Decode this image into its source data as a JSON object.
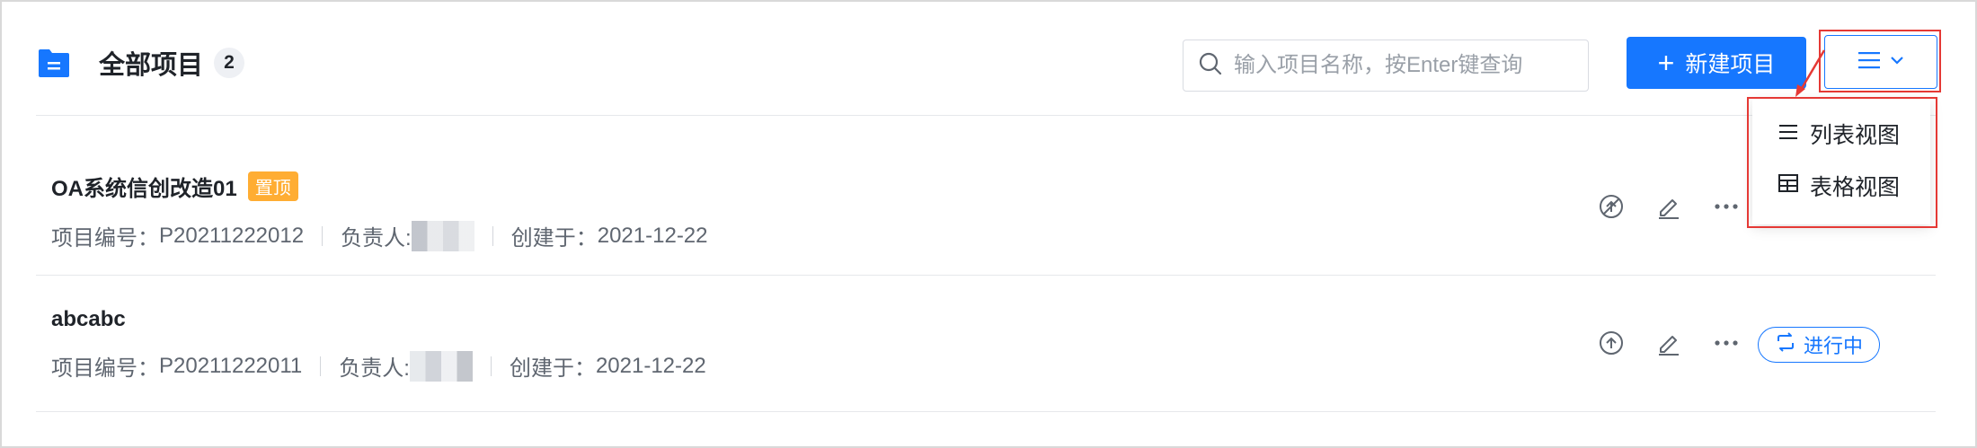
{
  "header": {
    "title": "全部项目",
    "count": "2",
    "icon": "folder-icon",
    "accent": "#1677ff"
  },
  "search": {
    "placeholder": "输入项目名称，按Enter键查询",
    "value": ""
  },
  "toolbar": {
    "new_project_label": "新建项目",
    "view_toggle_icon": "list-icon"
  },
  "view_menu": {
    "items": [
      {
        "label": "列表视图",
        "icon": "list-icon"
      },
      {
        "label": "表格视图",
        "icon": "table-icon"
      }
    ]
  },
  "projects": [
    {
      "name": "OA系统信创改造01",
      "tag": "置顶",
      "number_label": "项目编号：",
      "number": "P20211222012",
      "owner_label": "负责人:",
      "created_label": "创建于：",
      "created": "2021-12-22",
      "actions": [
        "unpin-icon",
        "edit-icon",
        "more-icon"
      ],
      "tag_color": "#ffad33"
    },
    {
      "name": "abcabc",
      "number_label": "项目编号：",
      "number": "P20211222011",
      "owner_label": "负责人:",
      "created_label": "创建于：",
      "created": "2021-12-22",
      "actions": [
        "pin-icon",
        "edit-icon",
        "more-icon"
      ],
      "status": "进行中"
    }
  ],
  "colors": {
    "primary": "#1677ff",
    "highlight": "#e53935",
    "pin_tag": "#ffad33"
  }
}
